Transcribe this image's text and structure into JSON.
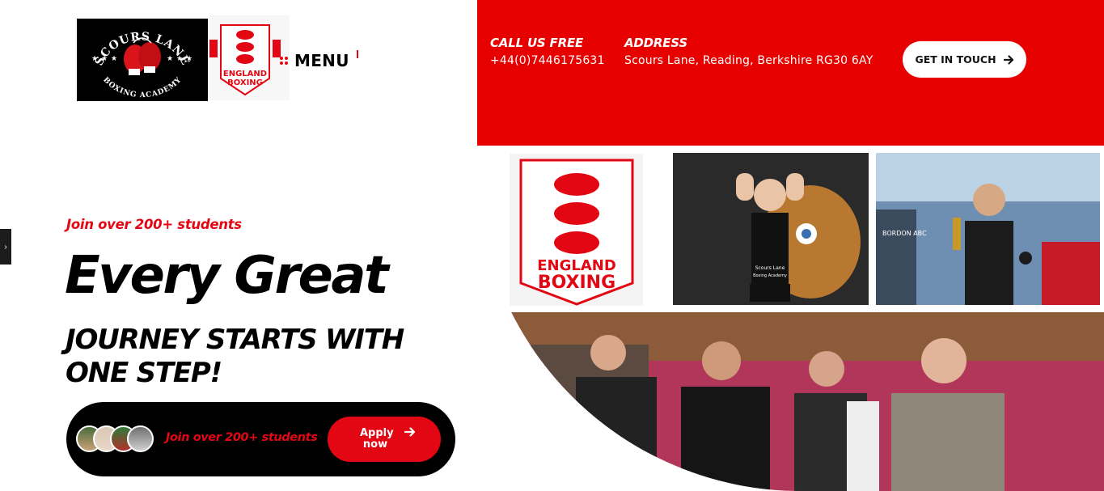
{
  "brand": {
    "academy_logo_text_top": "SCOURS LANE",
    "academy_logo_text_bottom": "BOXING ACADEMY",
    "england_logo_text_1": "ENGLAND",
    "england_logo_text_2": "BOXING"
  },
  "header": {
    "menu_label": "MENU",
    "call_title": "CALL US FREE",
    "call_value": "+44(0)7446175631",
    "address_title": "ADDRESS",
    "address_value": "Scours Lane, Reading, Berkshire RG30 6AY",
    "contact_button": "GET IN TOUCH",
    "accent_color": "#e70000"
  },
  "hero": {
    "tagline": "Join over 200+ students",
    "headline": "Every Great",
    "subheadline": "JOURNEY STARTS WITH ONE STEP!",
    "cta_text": "Join over 200+ students",
    "apply_button": "Apply now"
  },
  "collage": {
    "poster_text_1": "ENGLAND",
    "poster_text_2": "BOXING",
    "vest_text_1": "Scours Lane",
    "vest_text_2": "Boxing Academy",
    "banner_text": "BORDON ABC"
  },
  "icons": [
    "menu-dots-icon",
    "arrow-right-icon",
    "chevron-right-icon"
  ]
}
